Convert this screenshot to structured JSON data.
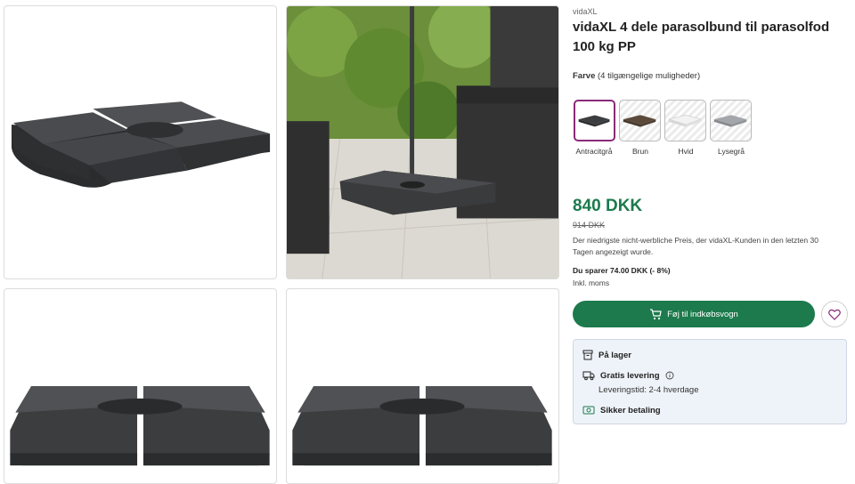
{
  "product": {
    "brand": "vidaXL",
    "title": "vidaXL 4 dele parasolbund til parasolfod 100 kg PP"
  },
  "color_selector": {
    "label": "Farve",
    "count_text": "(4 tilgængelige muligheder)",
    "options": [
      {
        "label": "Antracitgrå",
        "color": "#3c3d3f",
        "selected": true
      },
      {
        "label": "Brun",
        "color": "#5b4a3a",
        "selected": false
      },
      {
        "label": "Hvid",
        "color": "#e6e6e6",
        "selected": false
      },
      {
        "label": "Lysegrå",
        "color": "#a3a6aa",
        "selected": false
      }
    ]
  },
  "pricing": {
    "price": "840 DKK",
    "old_price": "914 DKK",
    "note": "Der niedrigste nicht-werbliche Preis, der vidaXL-Kunden in den letzten 30 Tagen angezeigt wurde.",
    "savings": "Du sparer 74.00 DKK (- 8%)",
    "vat": "Inkl. moms"
  },
  "actions": {
    "add_to_cart": "Føj til indkøbsvogn"
  },
  "delivery": {
    "stock": "På lager",
    "free_delivery": "Gratis levering",
    "delivery_time": "Leveringstid: 2-4 hverdage",
    "secure_payment": "Sikker betaling"
  },
  "colors": {
    "accent": "#1c7a4c",
    "selected_border": "#8a2a7a",
    "product_dark": "#3c3d3f",
    "info_box": "#eef3f9"
  }
}
